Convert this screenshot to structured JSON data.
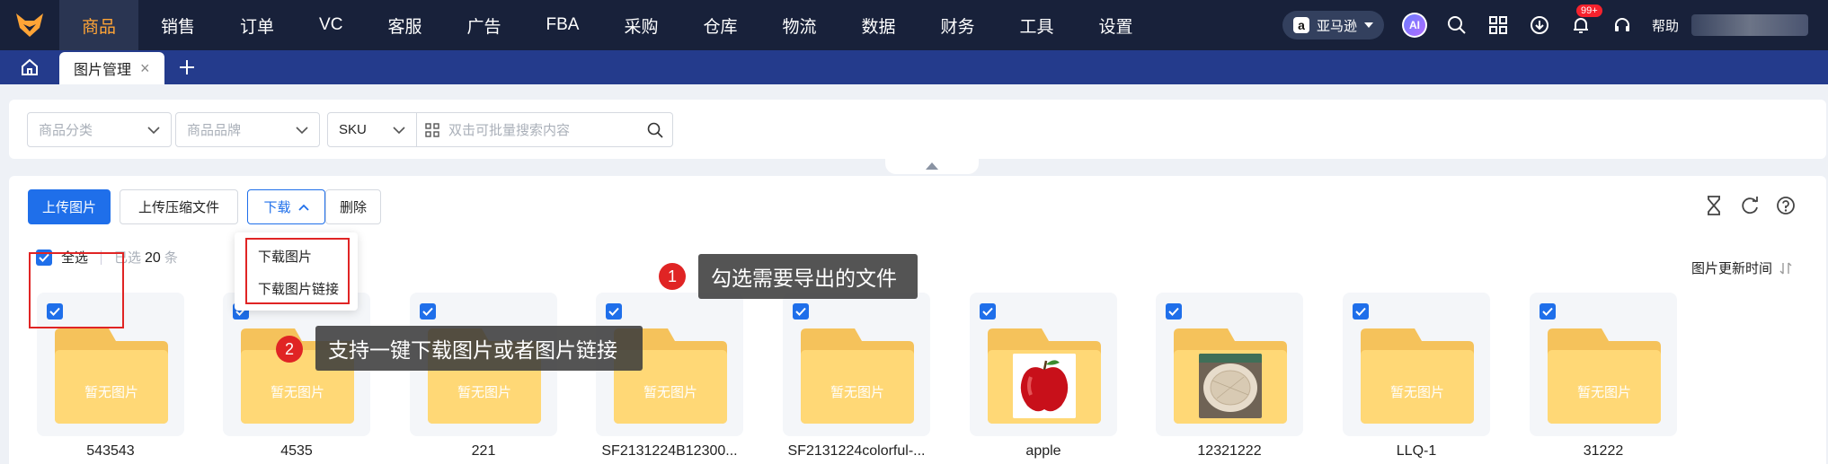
{
  "nav": {
    "items": [
      "商品",
      "销售",
      "订单",
      "VC",
      "客服",
      "广告",
      "FBA",
      "采购",
      "仓库",
      "物流",
      "数据",
      "财务",
      "工具",
      "设置"
    ],
    "active_index": 0,
    "store_label": "亚马逊",
    "ai_label": "AI",
    "notification_badge": "99+",
    "help_label": "帮助"
  },
  "tabs": {
    "items": [
      {
        "label": "图片管理"
      }
    ]
  },
  "filters": {
    "category_placeholder": "商品分类",
    "brand_placeholder": "商品品牌",
    "search_type": "SKU",
    "search_placeholder": "双击可批量搜索内容"
  },
  "toolbar": {
    "upload_image": "上传图片",
    "upload_zip": "上传压缩文件",
    "download": "下载",
    "delete": "删除"
  },
  "download_menu": {
    "items": [
      "下载图片",
      "下载图片链接"
    ]
  },
  "selection": {
    "select_all": "全选",
    "selected_prefix": "已选",
    "selected_count": "20",
    "selected_suffix": "条",
    "sort_label": "图片更新时间"
  },
  "cards": [
    {
      "name": "543543",
      "placeholder": "暂无图片",
      "image": "none"
    },
    {
      "name": "4535",
      "placeholder": "暂无图片",
      "image": "none"
    },
    {
      "name": "221",
      "placeholder": "暂无图片",
      "image": "none"
    },
    {
      "name": "SF2131224B12300...",
      "placeholder": "暂无图片",
      "image": "none"
    },
    {
      "name": "SF2131224colorful-...",
      "placeholder": "暂无图片",
      "image": "none"
    },
    {
      "name": "apple",
      "placeholder": "",
      "image": "apple-photo"
    },
    {
      "name": "12321222",
      "placeholder": "",
      "image": "plate-photo"
    },
    {
      "name": "LLQ-1",
      "placeholder": "暂无图片",
      "image": "none"
    },
    {
      "name": "31222",
      "placeholder": "暂无图片",
      "image": "none"
    }
  ],
  "annotations": [
    {
      "number": "1",
      "text": "勾选需要导出的文件"
    },
    {
      "number": "2",
      "text": "支持一键下载图片或者图片链接"
    }
  ],
  "colors": {
    "nav_bg": "#18213a",
    "nav_active_text": "#ffa436",
    "tab_bar_bg": "#243b8c",
    "primary": "#1f6fea",
    "highlight_red": "#e02424",
    "folder_yellow": "#ffd876"
  }
}
